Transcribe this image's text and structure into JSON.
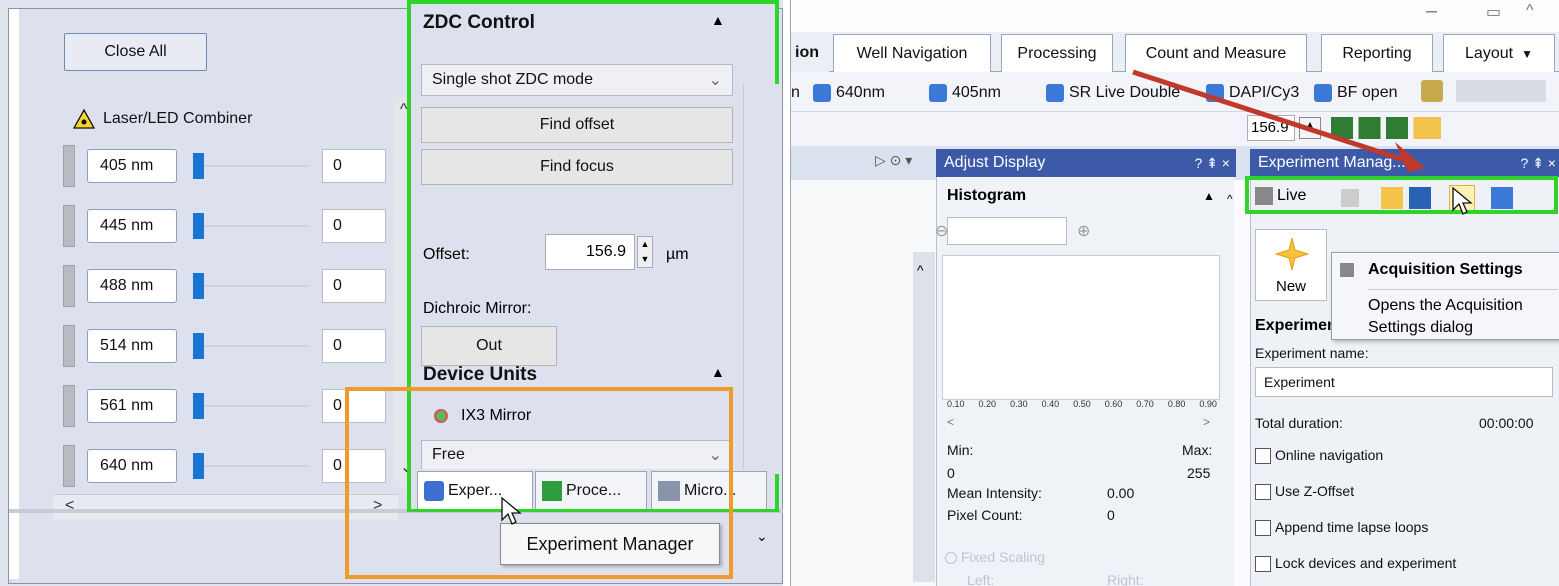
{
  "left": {
    "close_all": "Close All",
    "laser_section": "Laser/LED Combiner",
    "lasers": [
      {
        "label": "405 nm",
        "value": "0",
        "level": 0.05
      },
      {
        "label": "445 nm",
        "value": "0",
        "level": 0.05
      },
      {
        "label": "488 nm",
        "value": "0",
        "level": 0.05
      },
      {
        "label": "514 nm",
        "value": "0",
        "level": 0.05
      },
      {
        "label": "561 nm",
        "value": "0",
        "level": 0.05
      },
      {
        "label": "640 nm",
        "value": "0",
        "level": 0.05
      }
    ],
    "zdc": {
      "title": "ZDC Control",
      "mode": "Single shot ZDC mode",
      "find_offset": "Find offset",
      "find_focus": "Find focus",
      "offset_label": "Offset:",
      "offset_value": "156.9",
      "offset_unit": "µm",
      "dichroic_label": "Dichroic Mirror:",
      "dichroic_value": "Out"
    },
    "device_units": {
      "title": "Device Units",
      "mirror_label": "IX3 Mirror",
      "mirror_value": "Free"
    },
    "tabs": [
      "Exper...",
      "Proce...",
      "Micro..."
    ],
    "tooltip": "Experiment Manager"
  },
  "right": {
    "tabs": [
      "ion",
      "Well Navigation",
      "Processing",
      "Count and Measure",
      "Reporting",
      "Layout"
    ],
    "toolbar": [
      "n",
      "640nm",
      "405nm",
      "SR Live Double",
      "DAPI/Cy3",
      "BF open"
    ],
    "zoom_value": "156.9",
    "adjust_display": {
      "title": "Adjust Display",
      "histogram": "Histogram",
      "ticks": [
        "0.10",
        "0.20",
        "0.30",
        "0.40",
        "0.50",
        "0.60",
        "0.70",
        "0.80",
        "0.90"
      ],
      "min_label": "Min:",
      "max_label": "Max:",
      "min_value": "0",
      "max_value": "255",
      "mean_label": "Mean Intensity:",
      "mean_value": "0.00",
      "pixel_label": "Pixel Count:",
      "pixel_value": "0",
      "fixed_scaling": "Fixed Scaling",
      "left_label": "Left:",
      "right_label": "Right:"
    },
    "experiment_manager": {
      "title": "Experiment Manag...",
      "live_label": "Live",
      "new_label": "New",
      "section": "Experiment",
      "name_label": "Experiment name:",
      "name_value": "Experiment",
      "duration_label": "Total duration:",
      "duration_value": "00:00:00",
      "options": [
        "Online navigation",
        "Use Z-Offset",
        "Append time lapse loops",
        "Lock devices and experiment"
      ]
    },
    "tooltip": {
      "title": "Acquisition Settings",
      "body1": "Opens the Acquisition",
      "body2": "Settings dialog"
    },
    "pane_controls": "? ⇞ ×"
  },
  "colors": {
    "highlight_green": "#2fd32a",
    "highlight_orange": "#f09a2d",
    "arrow_red": "#c0392b",
    "slider_blue": "#1a75d2",
    "dock_header_blue": "#3c5aa8"
  }
}
